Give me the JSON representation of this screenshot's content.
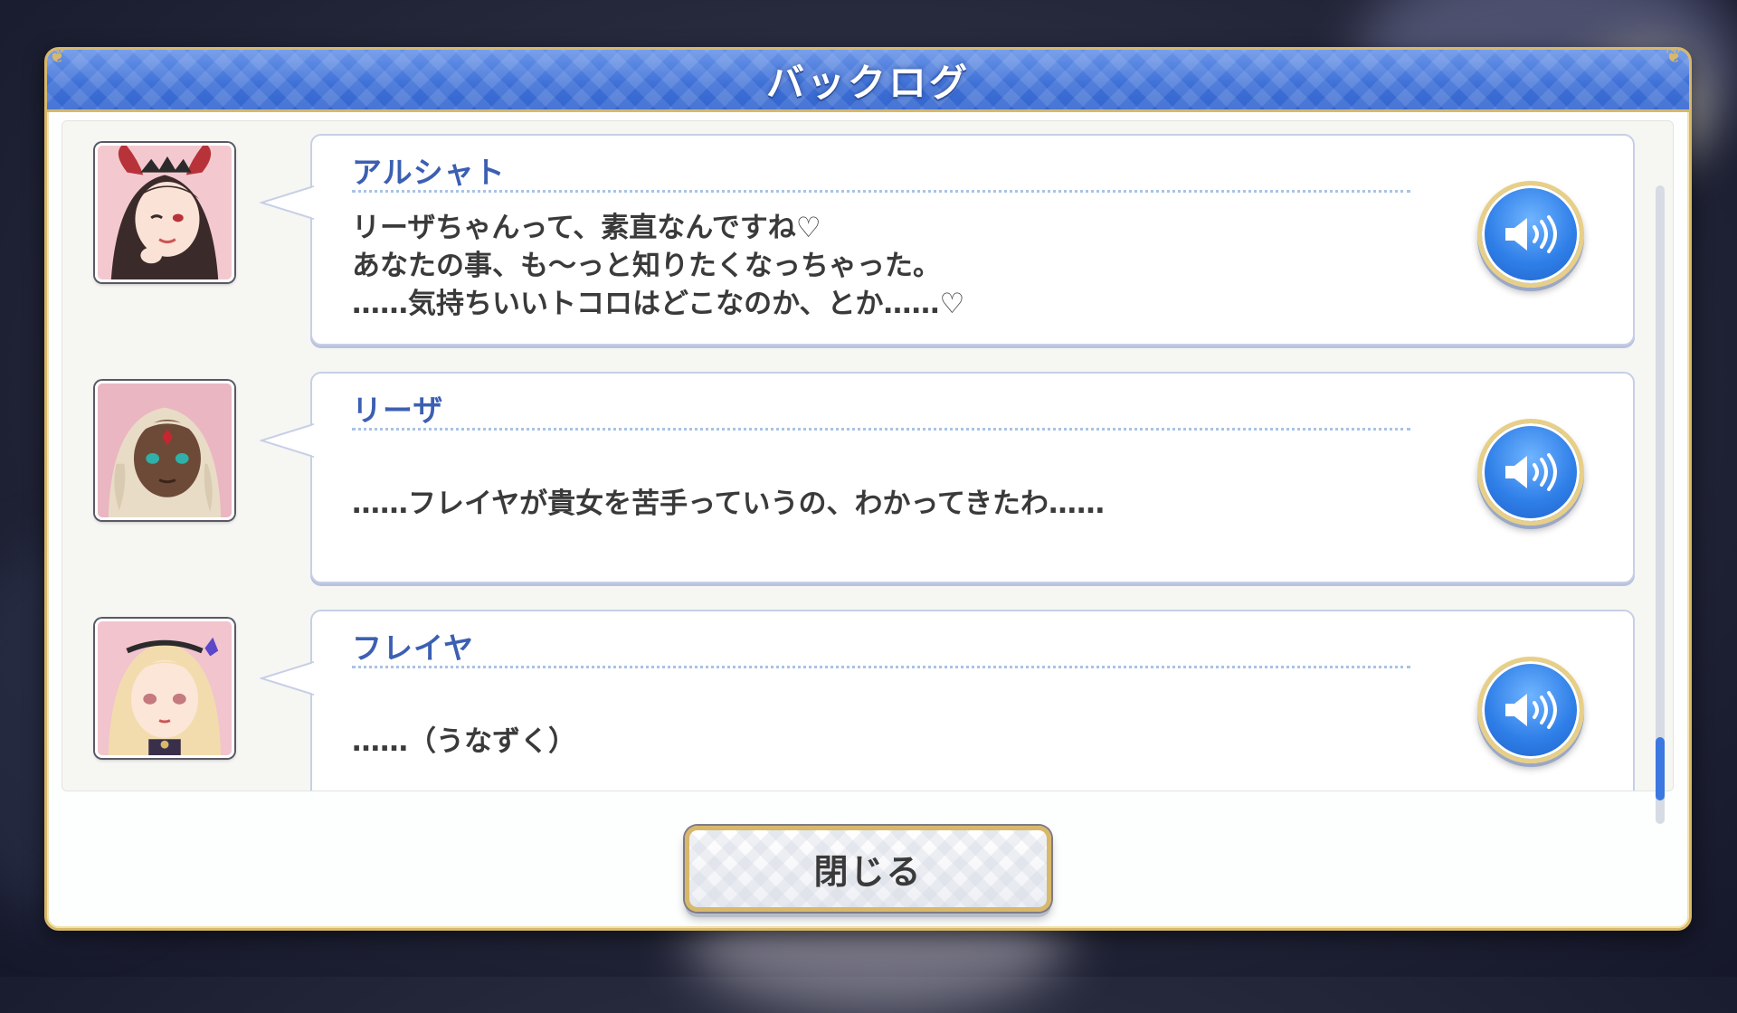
{
  "dialog": {
    "title": "バックログ",
    "close_label": "閉じる"
  },
  "entries": [
    {
      "speaker": "アルシャト",
      "lines": [
        "リーザちゃんって、素直なんですね♡",
        "あなたの事、も〜っと知りたくなっちゃった。",
        "……気持ちいいトコロはどこなのか、とか……♡"
      ],
      "voice_icon": "speaker-volume-icon"
    },
    {
      "speaker": "リーザ",
      "lines": [
        "……フレイヤが貴女を苦手っていうの、わかってきたわ……"
      ],
      "voice_icon": "speaker-volume-icon"
    },
    {
      "speaker": "フレイヤ",
      "lines": [
        "……（うなずく）"
      ],
      "voice_icon": "speaker-volume-icon"
    }
  ],
  "colors": {
    "header_blue": "#3d6fd6",
    "gold_border": "#d8b86a",
    "speaker_name": "#3c5fb2",
    "voice_button": "#2f7fe8",
    "scroll_thumb": "#3b78e0"
  }
}
